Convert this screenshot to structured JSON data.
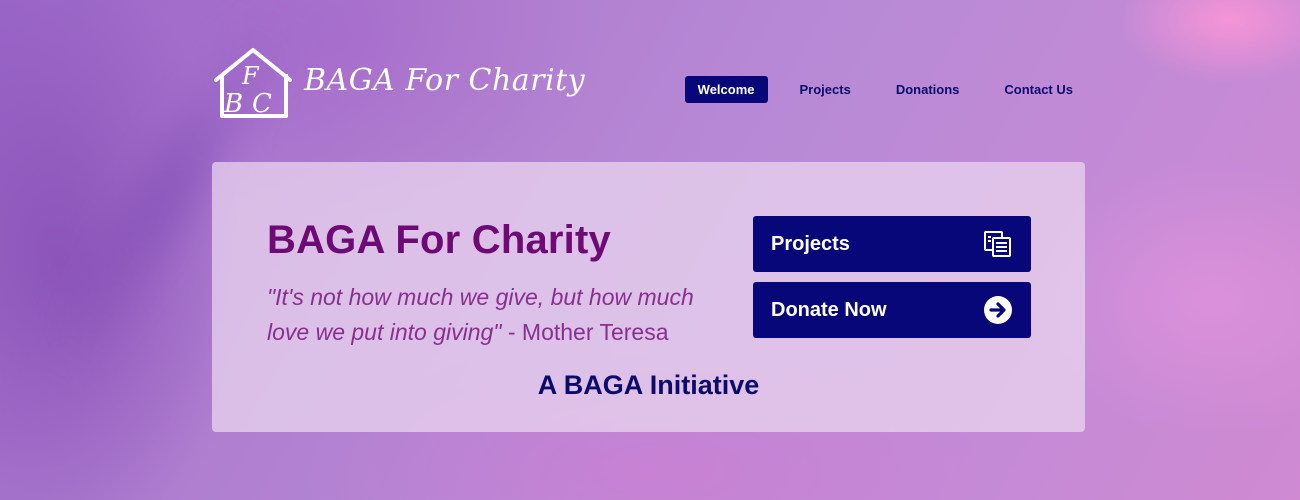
{
  "brand": {
    "name": "BAGA For Charity",
    "monogram": "FBC"
  },
  "nav": {
    "items": [
      {
        "label": "Welcome",
        "active": true
      },
      {
        "label": "Projects",
        "active": false
      },
      {
        "label": "Donations",
        "active": false
      },
      {
        "label": "Contact Us",
        "active": false
      }
    ]
  },
  "hero": {
    "title": "BAGA For Charity",
    "quote": "\"It's not how much we give, but how much love we put into giving\"",
    "quote_author": " - Mother Teresa",
    "initiative": "A BAGA Initiative"
  },
  "buttons": {
    "projects": {
      "label": "Projects",
      "icon": "documents-icon"
    },
    "donate": {
      "label": "Donate Now",
      "icon": "arrow-circle-right-icon"
    }
  },
  "colors": {
    "accent_navy": "#07077a",
    "title_purple": "#6d0a73",
    "quote_purple": "#8a2f8f"
  }
}
